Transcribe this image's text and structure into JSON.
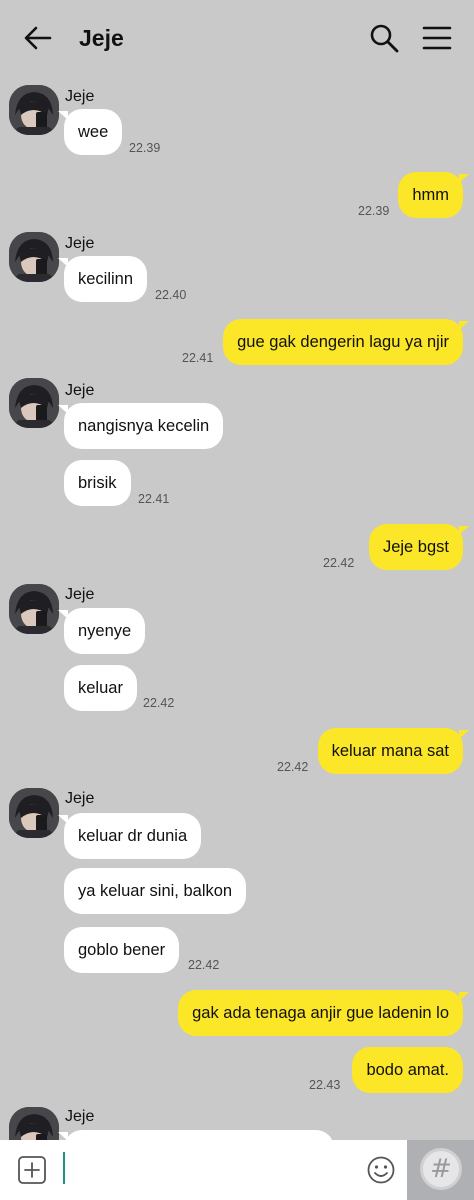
{
  "header": {
    "title": "Jeje",
    "back_icon": "arrow-left-icon",
    "search_icon": "search-icon",
    "menu_icon": "hamburger-menu-icon"
  },
  "colors": {
    "background": "#c9c9c9",
    "incoming_bubble": "#ffffff",
    "outgoing_bubble": "#fbe627",
    "timestamp": "#555555"
  },
  "messages": [
    {
      "from": "Jeje",
      "sender_label": "Jeje",
      "texts": [
        "wee"
      ],
      "time": "22.39"
    },
    {
      "from": "me",
      "texts": [
        "hmm"
      ],
      "time": "22.39"
    },
    {
      "from": "Jeje",
      "sender_label": "Jeje",
      "texts": [
        "kecilinn"
      ],
      "time": "22.40"
    },
    {
      "from": "me",
      "texts": [
        "gue gak dengerin lagu ya njir"
      ],
      "time": "22.41"
    },
    {
      "from": "Jeje",
      "sender_label": "Jeje",
      "texts": [
        "nangisnya kecelin",
        "brisik"
      ],
      "time": "22.41"
    },
    {
      "from": "me",
      "texts": [
        "Jeje bgst"
      ],
      "time": "22.42"
    },
    {
      "from": "Jeje",
      "sender_label": "Jeje",
      "texts": [
        "nyenye",
        "keluar"
      ],
      "time": "22.42"
    },
    {
      "from": "me",
      "texts": [
        "keluar mana sat"
      ],
      "time": "22.42"
    },
    {
      "from": "Jeje",
      "sender_label": "Jeje",
      "texts": [
        "keluar dr dunia",
        "ya keluar sini, balkon",
        "goblo bener"
      ],
      "time": "22.42"
    },
    {
      "from": "me",
      "texts": [
        "gak ada tenaga anjir gue ladenin lo",
        "bodo amat."
      ],
      "time": "22.43"
    },
    {
      "from": "Jeje",
      "sender_label": "Jeje",
      "texts": [
        ""
      ],
      "time": ""
    }
  ],
  "input_bar": {
    "value": "",
    "plus_icon": "plus-square-icon",
    "emoji_icon": "smiley-icon",
    "hash_icon": "hash-icon"
  }
}
